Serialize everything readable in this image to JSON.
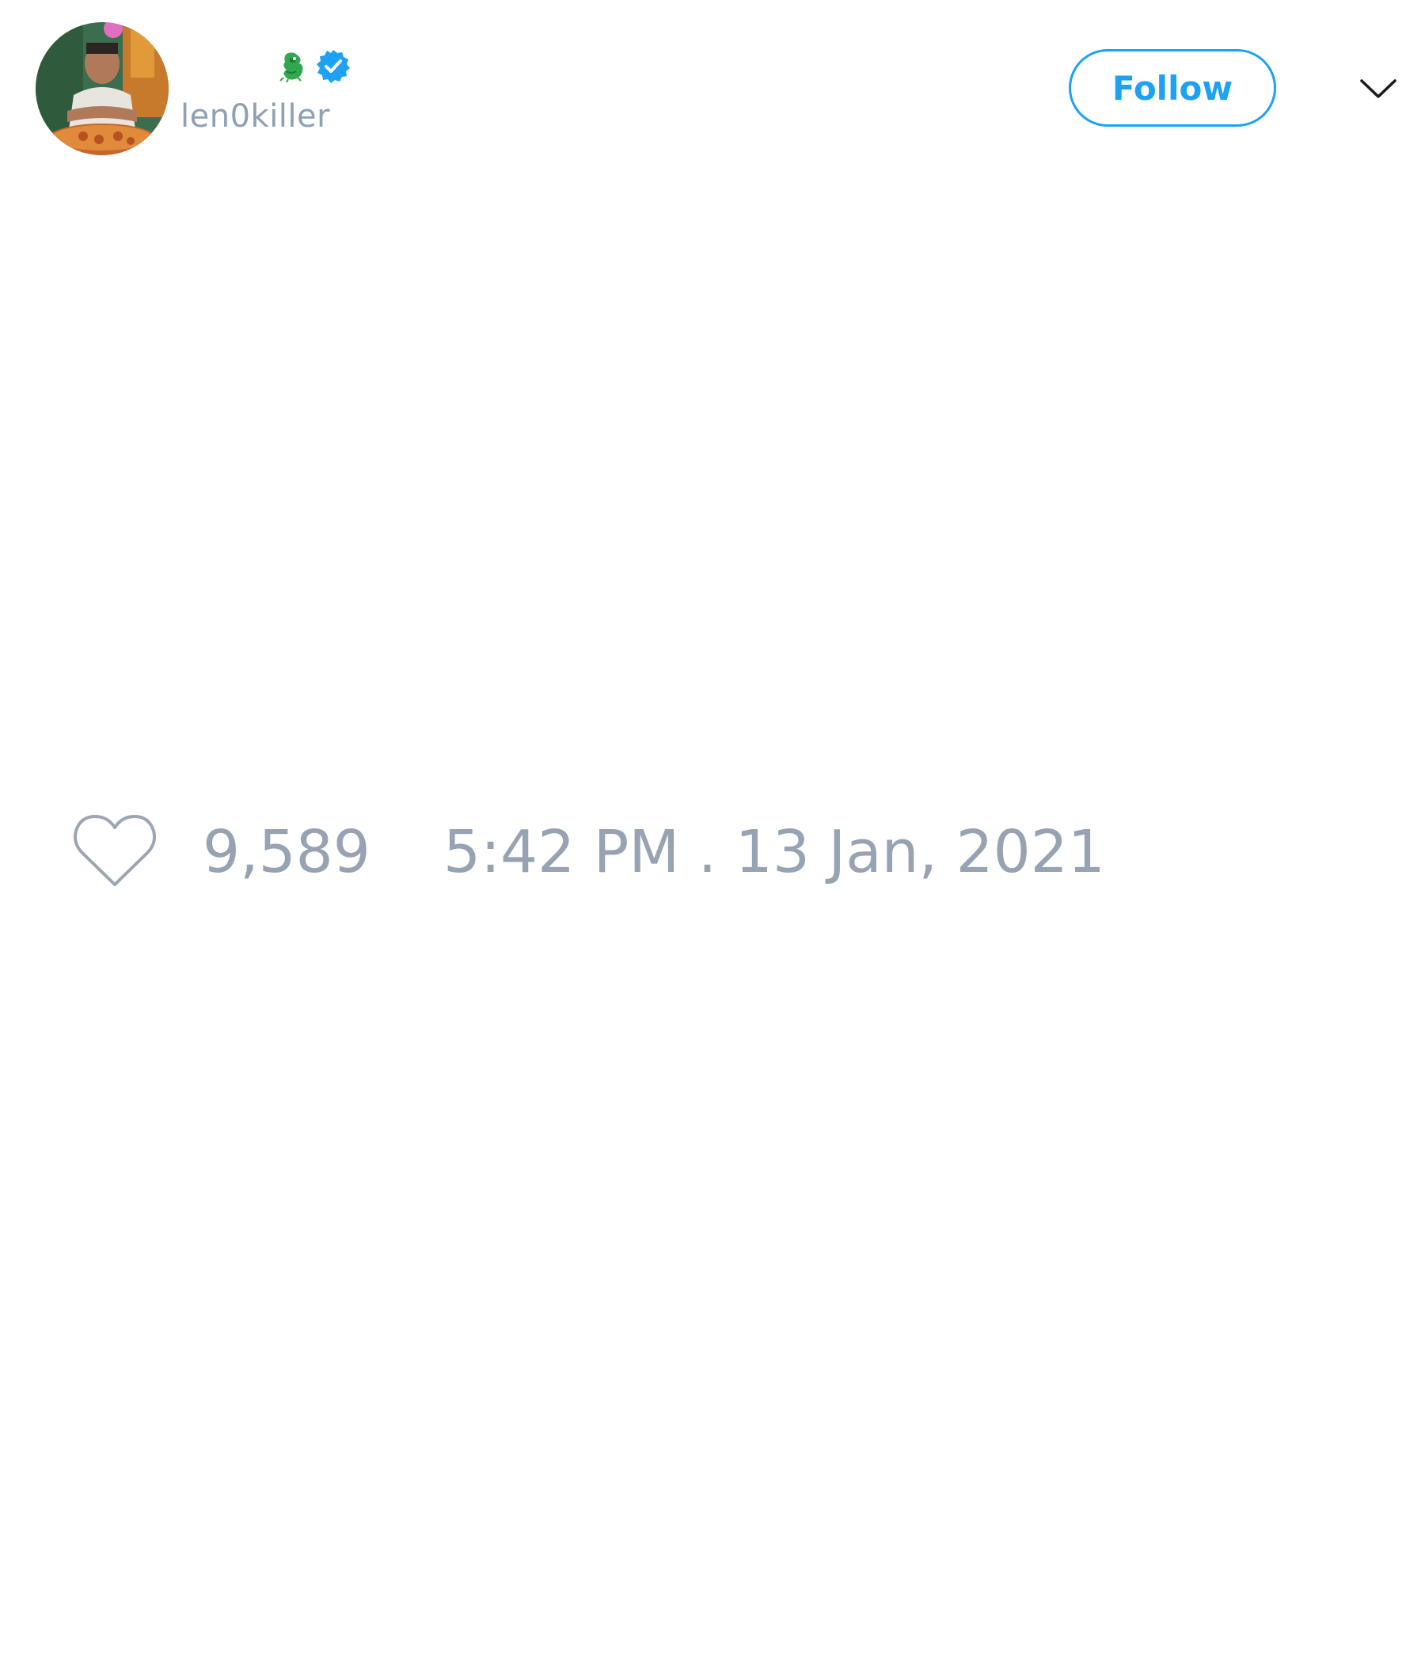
{
  "tweet": {
    "author": {
      "handle": "len0killer",
      "verified": true,
      "name_emoji_icon": "dragon-icon",
      "avatar": "profile-photo"
    },
    "follow_button_label": "Follow",
    "menu_icon": "chevron-down-icon",
    "likes": {
      "icon": "heart-icon",
      "count": "9,589"
    },
    "timestamp": "5:42 PM . 13 Jan, 2021"
  },
  "colors": {
    "accent": "#1da1f2",
    "muted_text": "#97a3b3",
    "background": "#ffffff"
  }
}
